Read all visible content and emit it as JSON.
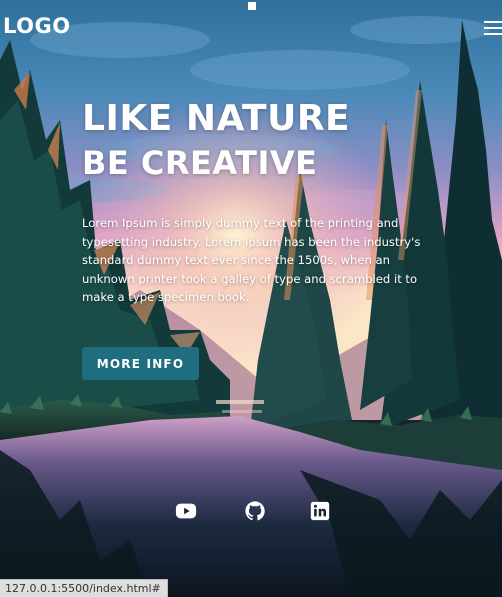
{
  "header": {
    "logo": "LOGO",
    "menu_icon": "hamburger-menu-icon"
  },
  "hero": {
    "title_line1": "LIKE NATURE",
    "title_line2": "BE CREATIVE",
    "description": "Lorem Ipsum is simply dummy text of the printing and typesetting industry. Lorem Ipsum has been the industry's standard dummy text ever since the 1500s, when an unknown printer took a galley of type and scrambled it to make a type specimen book.",
    "button_label": "MORE INFO"
  },
  "social": [
    {
      "icon": "youtube-icon"
    },
    {
      "icon": "github-icon"
    },
    {
      "icon": "linkedin-icon"
    }
  ],
  "status_bar": {
    "url": "127.0.0.1:5500/index.html#"
  },
  "colors": {
    "button": "#1f6e80",
    "text": "#ffffff"
  }
}
